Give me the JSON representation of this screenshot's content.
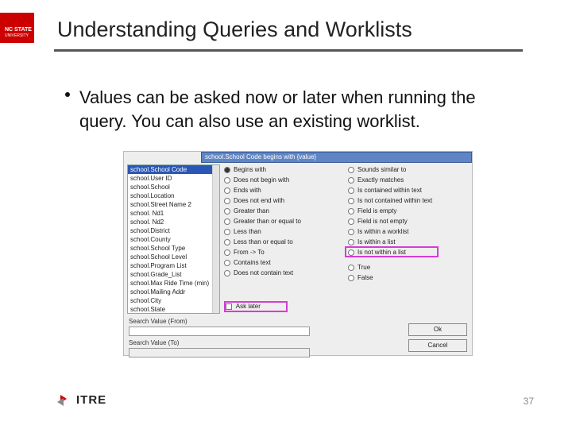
{
  "brand": {
    "line1": "NC STATE",
    "line2": "UNIVERSITY"
  },
  "title": "Understanding Queries and Worklists",
  "bullet": "Values can be asked now or later when running the query.  You can also use an existing worklist.",
  "shot": {
    "blueBar": "school.School Code  begins with {value}",
    "listItems": [
      "school.School Code",
      "school.User ID",
      "school.School",
      "school.Location",
      "school.Street Name 2",
      "school. Nd1",
      "school. Nd2",
      "school.District",
      "school.County",
      "school.School Type",
      "school.School Level",
      "school.Program List",
      "school.Grade_List",
      "school.Max Ride Time (min)",
      "school.Mailing Addr",
      "school.City",
      "school.State"
    ],
    "colA": [
      "Begins with",
      "Does not begin with",
      "Ends with",
      "Does not end with",
      "Greater than",
      "Greater than or equal to",
      "Less than",
      "Less than or equal to",
      "From -> To",
      "Contains text",
      "Does not contain text"
    ],
    "colB": [
      "Sounds similar to",
      "Exactly matches",
      "Is contained within text",
      "Is not contained within text",
      "Field is empty",
      "Field is not empty",
      "Is within a worklist",
      "Is within a list",
      "Is not within a list",
      "",
      "True",
      "False"
    ],
    "selectedA": 0,
    "askLater": "Ask later",
    "searchFrom": "Search Value (From)",
    "searchTo": "Search Value (To)",
    "ok": "Ok",
    "cancel": "Cancel"
  },
  "footer": {
    "itre": "ITRE",
    "page": "37"
  }
}
